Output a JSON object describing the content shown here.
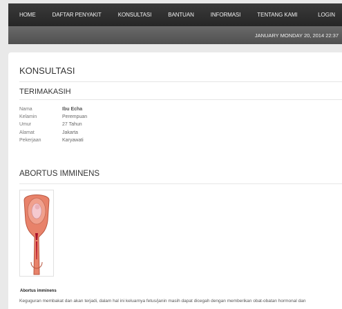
{
  "nav": {
    "items": [
      "HOME",
      "DAFTAR PENYAKIT",
      "KONSULTASI",
      "BANTUAN",
      "INFORMASI",
      "TENTANG KAMI"
    ],
    "login": "LOGIN"
  },
  "subbar": {
    "datetime": "JANUARY   MONDAY  20, 2014 22:37"
  },
  "page": {
    "title": "KONSULTASI",
    "thanks": "TERIMAKASIH",
    "patient": [
      {
        "label": "Nama",
        "value": "Ibu Echa"
      },
      {
        "label": "Kelamin",
        "value": "Perempuan"
      },
      {
        "label": "Umur",
        "value": "27 Tahun"
      },
      {
        "label": "Alamat",
        "value": "Jakarta"
      },
      {
        "label": "Pekerjaan",
        "value": "Karyawati"
      }
    ],
    "diagnosis": "ABORTUS IMMINENS",
    "figure_caption": "Abortus imminens",
    "description": "Keguguran membakat dan akan terjadi, dalam hal ini keluarnya fetus/janin masih dapat dicegah dengan memberikan obat-obatan hormonal dan"
  },
  "colors": {
    "topbar": "#2e2e2e",
    "subbar": "#5c5c5c",
    "background": "#e9e9e9",
    "uterus": "#e8826a",
    "fetus": "#f5c9cf"
  }
}
